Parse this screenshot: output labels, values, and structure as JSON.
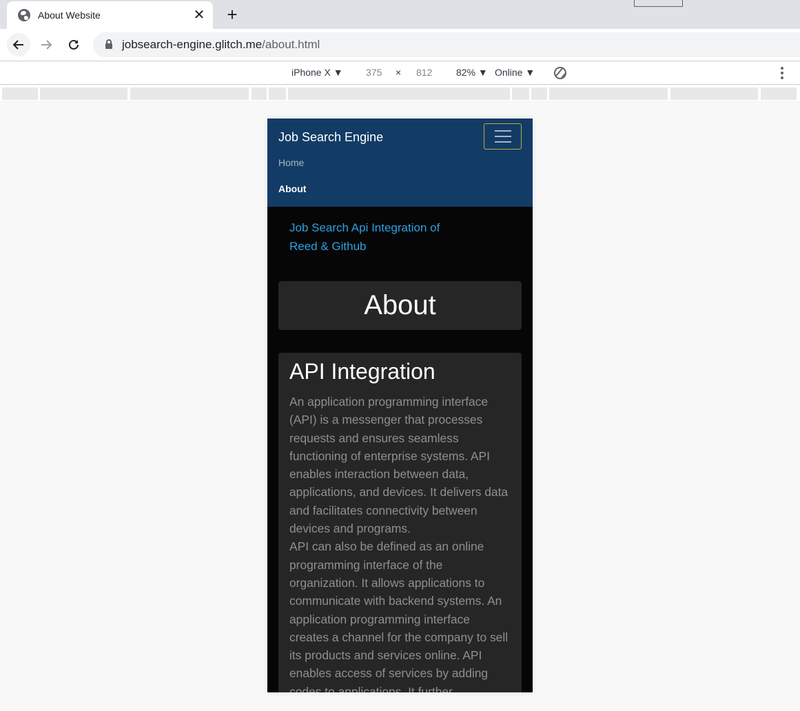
{
  "browser": {
    "tab_title": "About Website",
    "tab_close": "✕",
    "new_tab": "+",
    "url_host": "jobsearch-engine.glitch.me",
    "url_path": "/about.html"
  },
  "device_toolbar": {
    "device": "iPhone X ▼",
    "width": "375",
    "times": "×",
    "height": "812",
    "zoom": "82% ▼",
    "network": "Online ▼"
  },
  "page": {
    "brand": "Job Search Engine",
    "nav_home": "Home",
    "nav_about": "About",
    "subtitle": "Job Search Api Integration of Reed & Github",
    "heading": "About",
    "card_title": "API Integration",
    "card_text_1": "An application programming interface (API) is a messenger that processes requests and ensures seamless functioning of enterprise systems. API enables interaction between data, applications, and devices. It delivers data and facilitates connectivity between devices and programs.",
    "card_text_2": "API can also be defined as an online programming interface of the organization. It allows applications to communicate with backend systems. An application programming interface creates a channel for the company to sell its products and services online. API enables access of services by adding codes to applications. It further"
  }
}
